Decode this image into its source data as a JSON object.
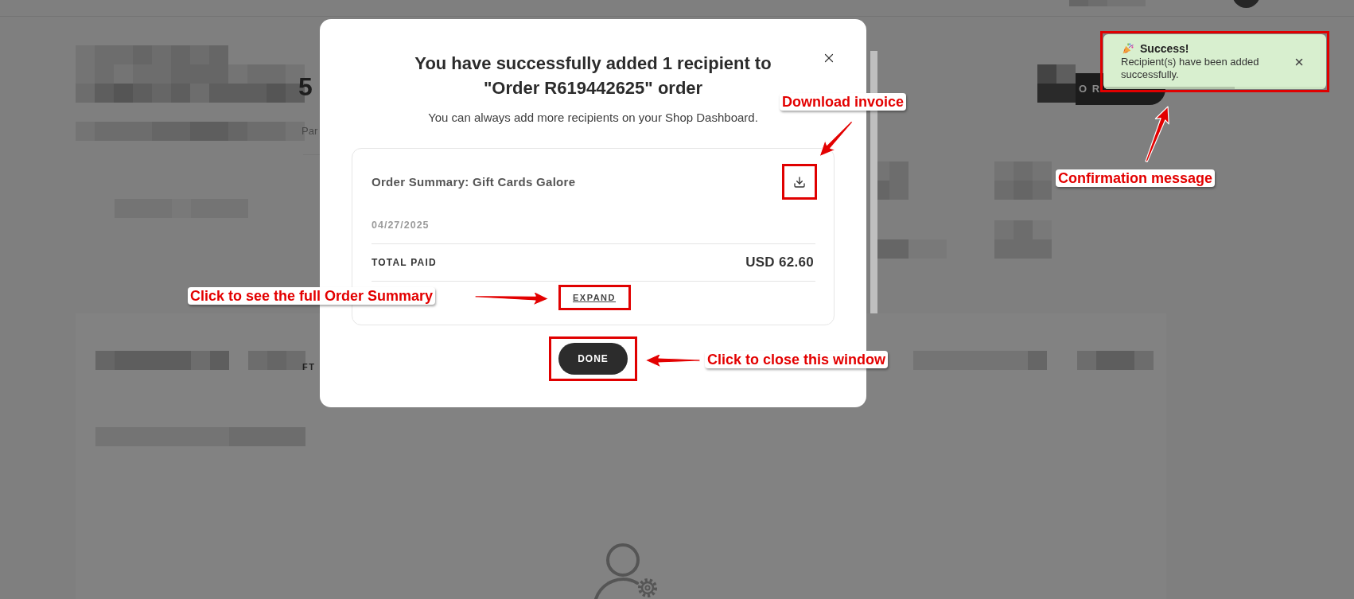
{
  "page": {
    "heading_fragment": "5",
    "subheading_fragment": "Par",
    "column_fragment": "FT",
    "button_fragment": "O R"
  },
  "modal": {
    "title": "You have successfully added 1 recipient to \"Order R619442625\" order",
    "subtitle": "You can always add more recipients on your Shop Dashboard.",
    "summary": {
      "title": "Order Summary: Gift Cards Galore",
      "download_highlighted": true,
      "date": "04/27/2025",
      "total_label": "TOTAL PAID",
      "total_value": "USD 62.60",
      "expand_label": "EXPAND",
      "expand_highlighted": true
    },
    "done_button": {
      "label": "DONE",
      "highlighted": true
    }
  },
  "toast": {
    "title": "Success!",
    "message": "Recipient(s) have been added successfully.",
    "highlighted": true,
    "timer": {
      "level": 0.59
    }
  },
  "annotations": [
    {
      "text": "Download invoice"
    },
    {
      "text": "Confirmation message"
    },
    {
      "text": "Click to see the full Order Summary"
    },
    {
      "text": "Click to close this window"
    }
  ]
}
